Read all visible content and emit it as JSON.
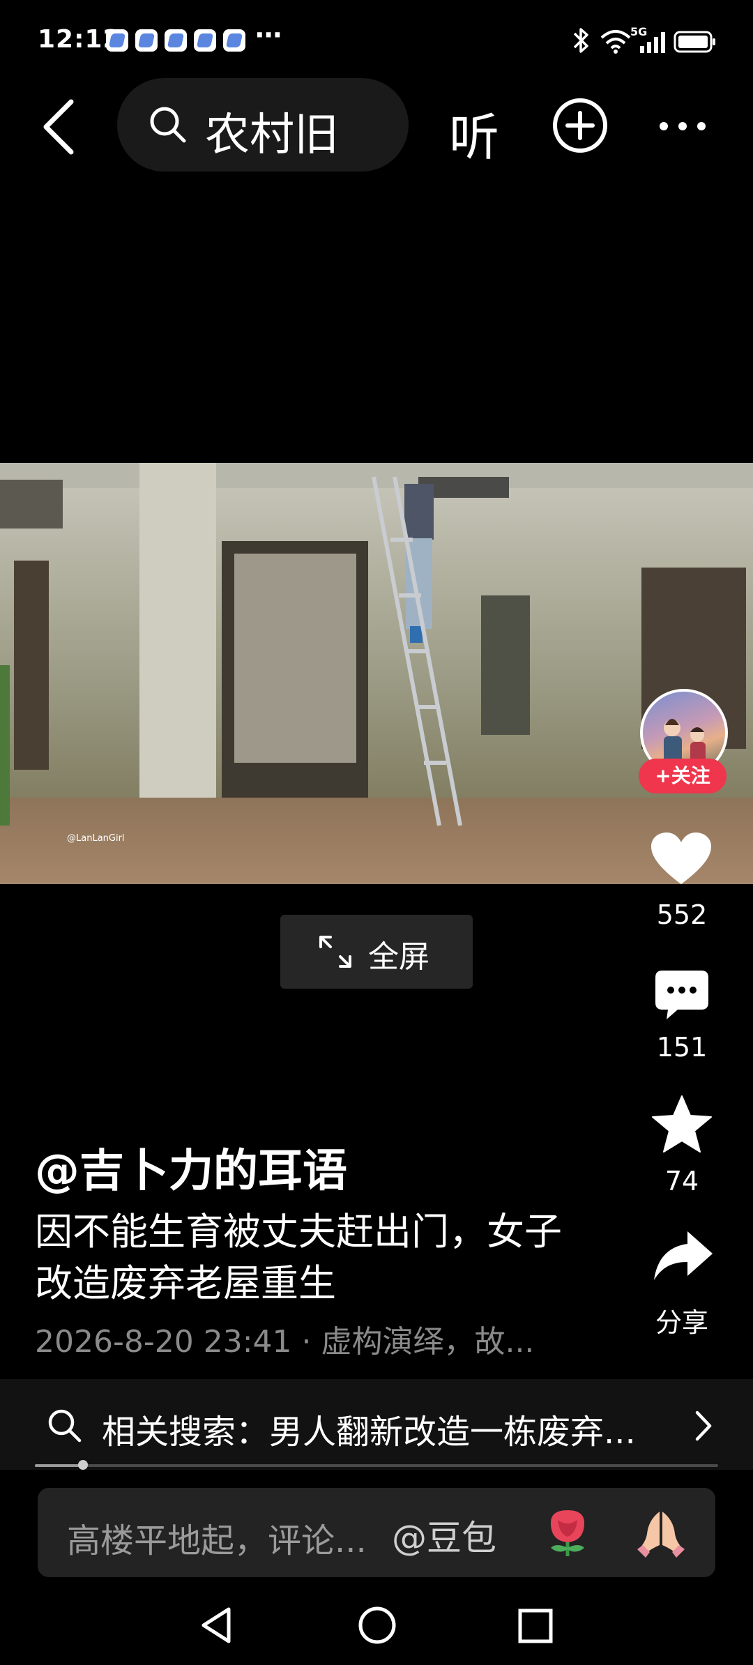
{
  "status_bar": {
    "time": "12:12",
    "overflow": "⋯",
    "network": "5G",
    "icons": [
      "bluetooth-icon",
      "wifi-icon",
      "signal-icon",
      "battery-icon"
    ]
  },
  "top_bar": {
    "search_query": "农村旧",
    "listen_label": "听"
  },
  "video": {
    "watermark": "@LanLanGirl",
    "fullscreen_label": "全屏"
  },
  "rail": {
    "follow_label": "+关注",
    "likes": "552",
    "comments": "151",
    "favorites": "74",
    "share_label": "分享"
  },
  "caption": {
    "author": "@吉卜力的耳语",
    "description": "因不能生育被丈夫赶出门，女子改造废弃老屋重生",
    "meta": "2026-8-20 23:41 · 虚构演绎，故..."
  },
  "related_search": {
    "text": "相关搜索：男人翻新改造一栋废弃..."
  },
  "comment_bar": {
    "placeholder": "高楼平地起，评论...",
    "mention": "@豆包"
  },
  "colors": {
    "background": "#000000",
    "follow": "#f0364c",
    "meta_text": "#8a8a8a"
  }
}
